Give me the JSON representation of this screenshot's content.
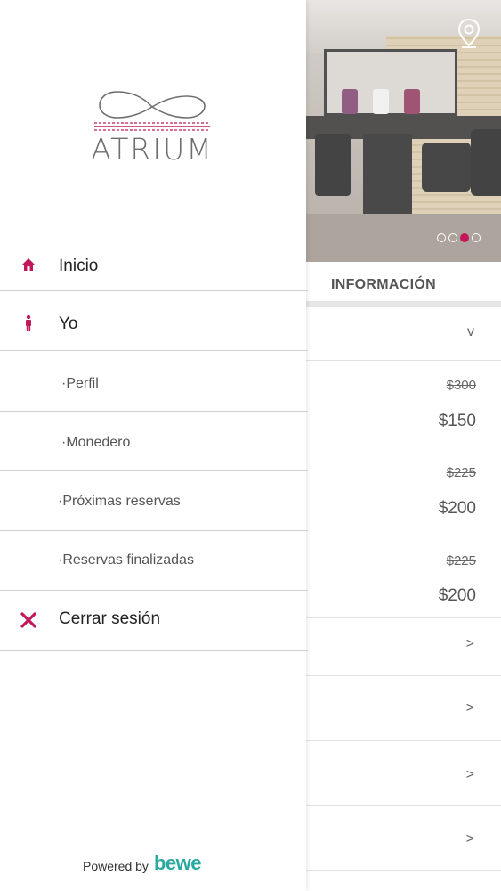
{
  "drawer": {
    "brand": "ATRIUM",
    "menu": [
      {
        "label": "Inicio",
        "icon": "home-icon"
      },
      {
        "label": "Yo",
        "icon": "person-icon"
      },
      {
        "label": "·Perfil"
      },
      {
        "label": "·Monedero"
      },
      {
        "label": "·Próximas reservas"
      },
      {
        "label": "·Reservas finalizadas"
      },
      {
        "label": "Cerrar sesión",
        "icon": "close-icon"
      }
    ],
    "powered_by": "Powered by",
    "powered_brand": "bewe"
  },
  "background": {
    "section_title": "INFORMACIÓN",
    "carousel": {
      "count": 4,
      "active_index": 2
    },
    "prices": [
      {
        "old": "$300",
        "new": "$150"
      },
      {
        "old": "$225",
        "new": "$200"
      },
      {
        "old": "$225",
        "new": "$200"
      }
    ],
    "chevron_down": "v",
    "chevron_right": ">"
  },
  "colors": {
    "accent": "#c2185b",
    "bewe": "#2aa9a1"
  }
}
